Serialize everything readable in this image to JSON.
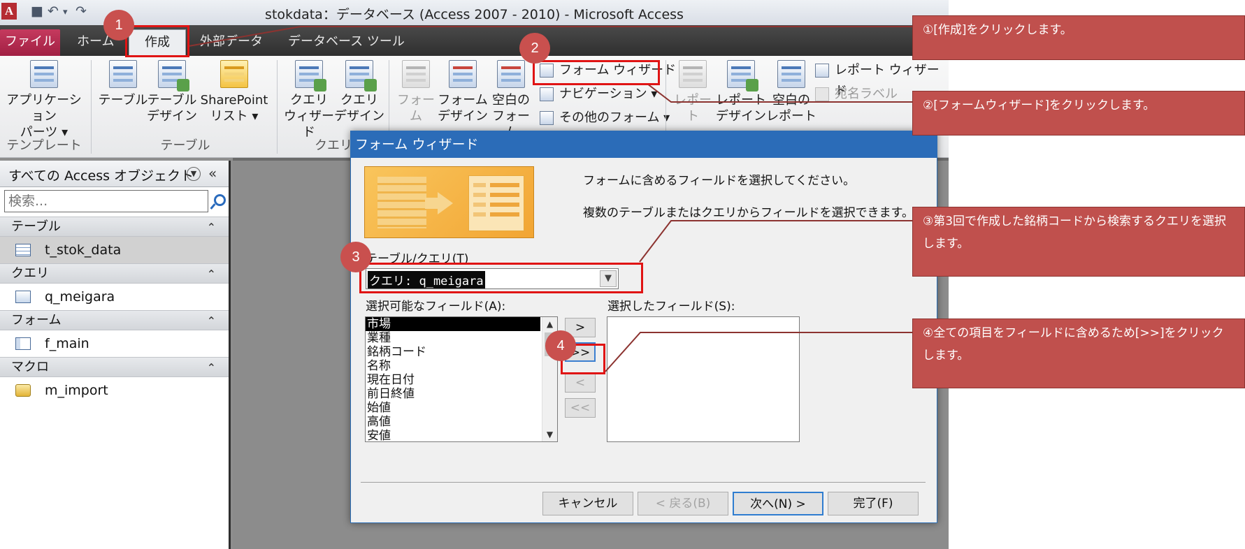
{
  "window": {
    "app_icon": "A",
    "title": "stokdata：データベース (Access 2007 - 2010) - Microsoft Access"
  },
  "quick_access": {
    "save_icon": "save-icon",
    "undo_icon": "undo-icon",
    "redo_icon": "redo-icon"
  },
  "tabs": [
    {
      "label": "ファイル"
    },
    {
      "label": "ホーム"
    },
    {
      "label": "作成"
    },
    {
      "label": "外部データ"
    },
    {
      "label": "データベース ツール"
    }
  ],
  "ribbon": {
    "template": {
      "app_parts": [
        "アプリケーション",
        "パーツ ▾"
      ],
      "group": "テンプレート"
    },
    "table": {
      "table": [
        "テーブル"
      ],
      "table_design": [
        "テーブル",
        "デザイン"
      ],
      "sharepoint": [
        "SharePoint",
        "リスト ▾"
      ],
      "group": "テーブル"
    },
    "query": {
      "wizard": [
        "クエリ",
        "ウィザード"
      ],
      "design": [
        "クエリ",
        "デザイン"
      ],
      "group": "クエリ"
    },
    "form": {
      "form": [
        "フォーム"
      ],
      "form_design": [
        "フォーム",
        "デザイン"
      ],
      "blank_form": [
        "空白の",
        "フォーム"
      ],
      "wizard": "フォーム ウィザード",
      "navigation": "ナビゲーション ▾",
      "more": "その他のフォーム ▾"
    },
    "report": {
      "report": [
        "レポート"
      ],
      "report_design": [
        "レポート",
        "デザイン"
      ],
      "blank_report": [
        "空白の",
        "レポート"
      ],
      "wizard": "レポート ウィザード",
      "labels": "宛名ラベル"
    }
  },
  "nav": {
    "title": "すべての Access オブジェクト",
    "search_placeholder": "検索...",
    "groups": [
      {
        "label": "テーブル",
        "items": [
          "t_stok_data"
        ]
      },
      {
        "label": "クエリ",
        "items": [
          "q_meigara"
        ]
      },
      {
        "label": "フォーム",
        "items": [
          "f_main"
        ]
      },
      {
        "label": "マクロ",
        "items": [
          "m_import"
        ]
      }
    ]
  },
  "dialog": {
    "title": "フォーム ウィザード",
    "instruction1": "フォームに含めるフィールドを選択してください。",
    "instruction2": "複数のテーブルまたはクエリからフィールドを選択できます。",
    "table_query_label": "テーブル/クエリ(T)",
    "table_query_value": "クエリ: q_meigara",
    "available_label": "選択可能なフィールド(A):",
    "available_fields": [
      "市場",
      "業種",
      "銘柄コード",
      "名称",
      "現在日付",
      "前日終値",
      "始値",
      "高値",
      "安値"
    ],
    "selected_label": "選択したフィールド(S):",
    "move_buttons": [
      ">",
      ">>",
      "<",
      "<<"
    ],
    "buttons": {
      "cancel": "キャンセル",
      "back": "< 戻る(B)",
      "next": "次へ(N) >",
      "finish": "完了(F)"
    }
  },
  "annotations": {
    "markers": [
      "1",
      "2",
      "3",
      "4"
    ],
    "callouts": [
      "①[作成]をクリックします。",
      "②[フォームウィザード]をクリックします。",
      "③第3回で作成した銘柄コードから検索するクエリを選択します。",
      "④全ての項目をフィールドに含めるため[>>]をクリックします。"
    ],
    "color": "#c0504d"
  }
}
